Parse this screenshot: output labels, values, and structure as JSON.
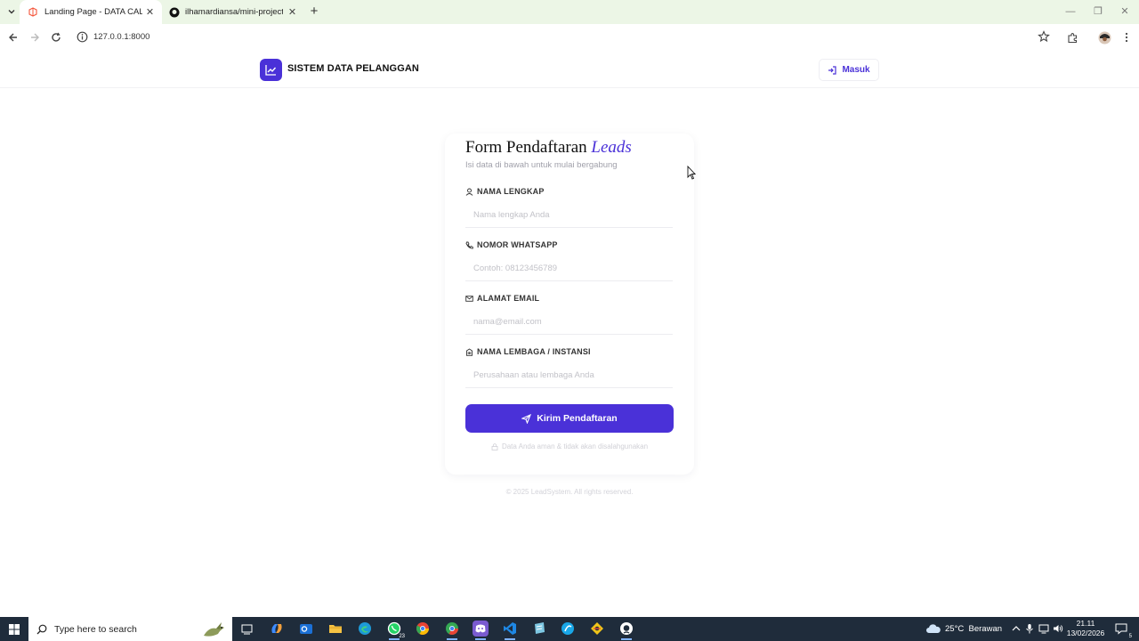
{
  "browser": {
    "tabs": [
      {
        "title": "Landing Page - DATA CALON P",
        "active": true
      },
      {
        "title": "ilhamardiansa/mini-project-wa",
        "active": false
      }
    ],
    "url": "127.0.0.1:8000"
  },
  "header": {
    "brand": "SISTEM DATA PELANGGAN",
    "login_label": "Masuk"
  },
  "form": {
    "title_main": "Form Pendaftaran",
    "title_accent": "Leads",
    "subtitle": "Isi data di bawah untuk mulai bergabung",
    "fields": [
      {
        "label": "NAMA LENGKAP",
        "placeholder": "Nama lengkap Anda",
        "icon": "user-icon"
      },
      {
        "label": "NOMOR WHATSAPP",
        "placeholder": "Contoh: 08123456789",
        "icon": "phone-icon"
      },
      {
        "label": "ALAMAT EMAIL",
        "placeholder": "nama@email.com",
        "icon": "mail-icon"
      },
      {
        "label": "NAMA LEMBAGA / INSTANSI",
        "placeholder": "Perusahaan atau lembaga Anda",
        "icon": "building-icon"
      }
    ],
    "submit_label": "Kirim Pendaftaran",
    "secure_note": "Data Anda aman & tidak akan disalahgunakan"
  },
  "footer": {
    "copyright": "© 2025 LeadSystem. All rights reserved."
  },
  "taskbar": {
    "search_placeholder": "Type here to search",
    "weather_temp": "25°C",
    "weather_desc": "Berawan",
    "time": "21.11",
    "date": "13/02/2026",
    "whatsapp_badge": "23",
    "notification_count": "5"
  },
  "colors": {
    "accent": "#4a31d8",
    "tab_bar": "#ecf6e6",
    "taskbar": "#1f2c3b"
  }
}
